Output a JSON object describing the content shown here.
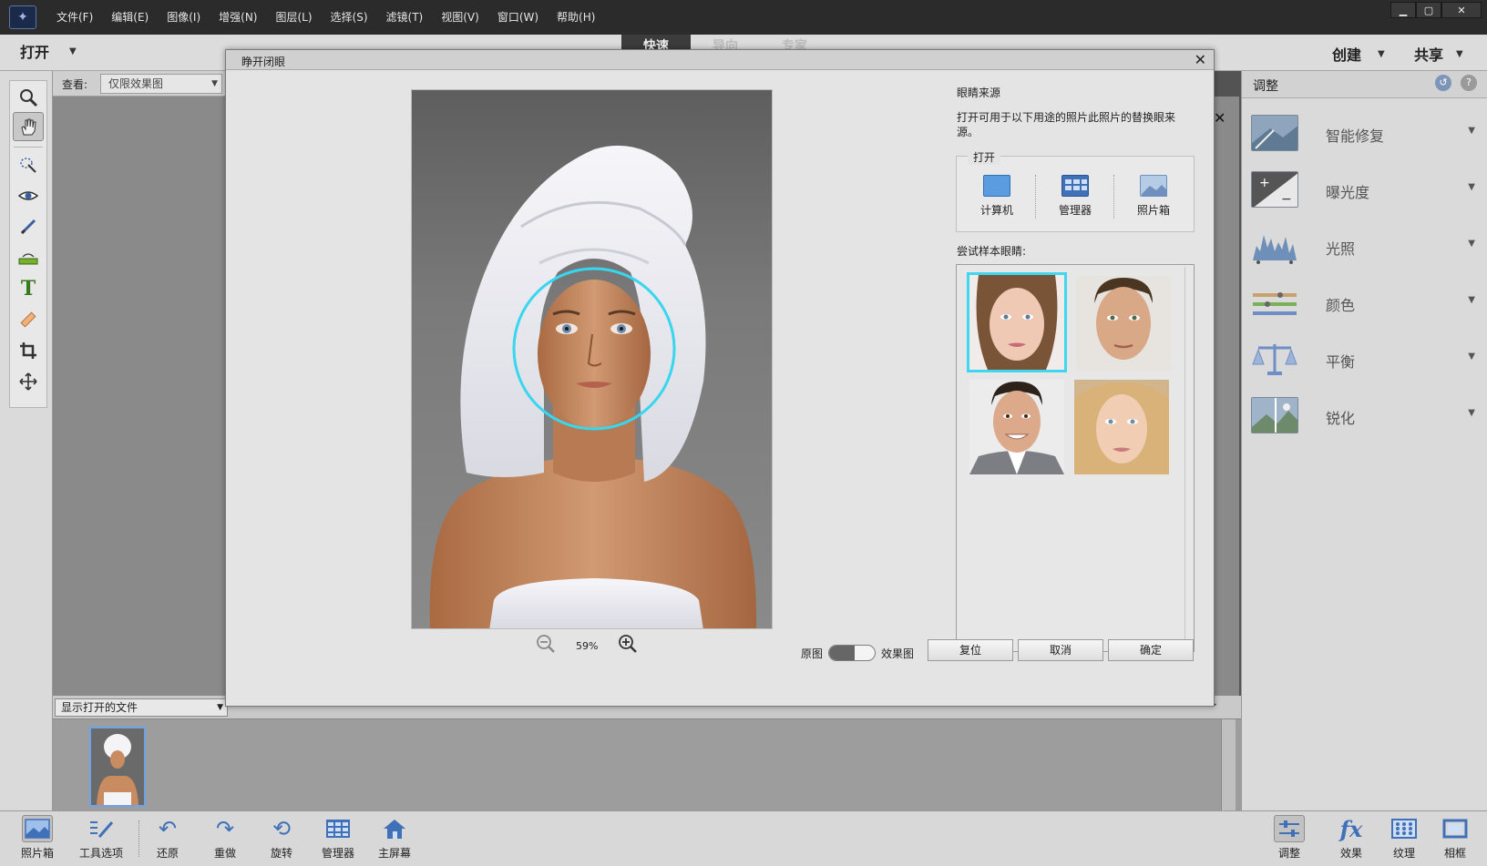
{
  "menu": {
    "items": [
      "文件(F)",
      "编辑(E)",
      "图像(I)",
      "增强(N)",
      "图层(L)",
      "选择(S)",
      "滤镜(T)",
      "视图(V)",
      "窗口(W)",
      "帮助(H)"
    ]
  },
  "toolbar2": {
    "open_label": "打开",
    "mode_tabs": [
      "快速",
      "导向",
      "专家"
    ],
    "create_label": "创建",
    "share_label": "共享"
  },
  "view": {
    "label": "查看:",
    "value": "仅限效果图"
  },
  "bin": {
    "select_value": "显示打开的文件"
  },
  "dialog": {
    "title": "睁开闭眼",
    "eyes_source_label": "眼睛来源",
    "description": "打开可用于以下用途的照片此照片的替换眼来源。",
    "open_group_label": "打开",
    "open_sources": [
      "计算机",
      "管理器",
      "照片箱"
    ],
    "samples_label": "尝试样本眼睛:",
    "zoom_value": "59%",
    "toggle_before": "原图",
    "toggle_after": "效果图",
    "buttons": {
      "reset": "复位",
      "cancel": "取消",
      "ok": "确定"
    }
  },
  "right_panel": {
    "title": "调整",
    "items": [
      {
        "label": "智能修复",
        "icon": "smart-fix-icon"
      },
      {
        "label": "曝光度",
        "icon": "exposure-icon"
      },
      {
        "label": "光照",
        "icon": "lighting-icon"
      },
      {
        "label": "颜色",
        "icon": "color-icon"
      },
      {
        "label": "平衡",
        "icon": "balance-icon"
      },
      {
        "label": "锐化",
        "icon": "sharpen-icon"
      }
    ]
  },
  "bottom_bar": {
    "left": [
      "照片箱",
      "工具选项",
      "还原",
      "重做",
      "旋转",
      "管理器",
      "主屏幕"
    ],
    "right": [
      "调整",
      "效果",
      "纹理",
      "相框"
    ]
  },
  "colors": {
    "accent": "#3fd7f0",
    "face_circle": "#38d6ef"
  }
}
